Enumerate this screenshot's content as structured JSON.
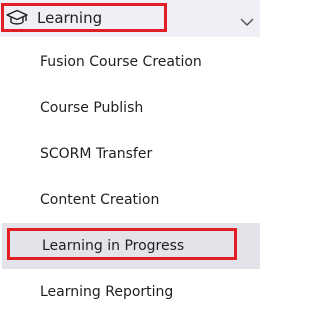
{
  "sidebar": {
    "section": {
      "label": "Learning",
      "icon": "graduation-cap-icon",
      "expand_icon": "chevron-down-icon",
      "highlight_color": "#e21d24"
    },
    "items": [
      {
        "label": "Fusion Course Creation",
        "active": false
      },
      {
        "label": "Course Publish",
        "active": false
      },
      {
        "label": "SCORM Transfer",
        "active": false
      },
      {
        "label": "Content Creation",
        "active": false
      },
      {
        "label": "Learning in Progress",
        "active": true
      },
      {
        "label": "Learning Reporting",
        "active": false
      }
    ]
  }
}
